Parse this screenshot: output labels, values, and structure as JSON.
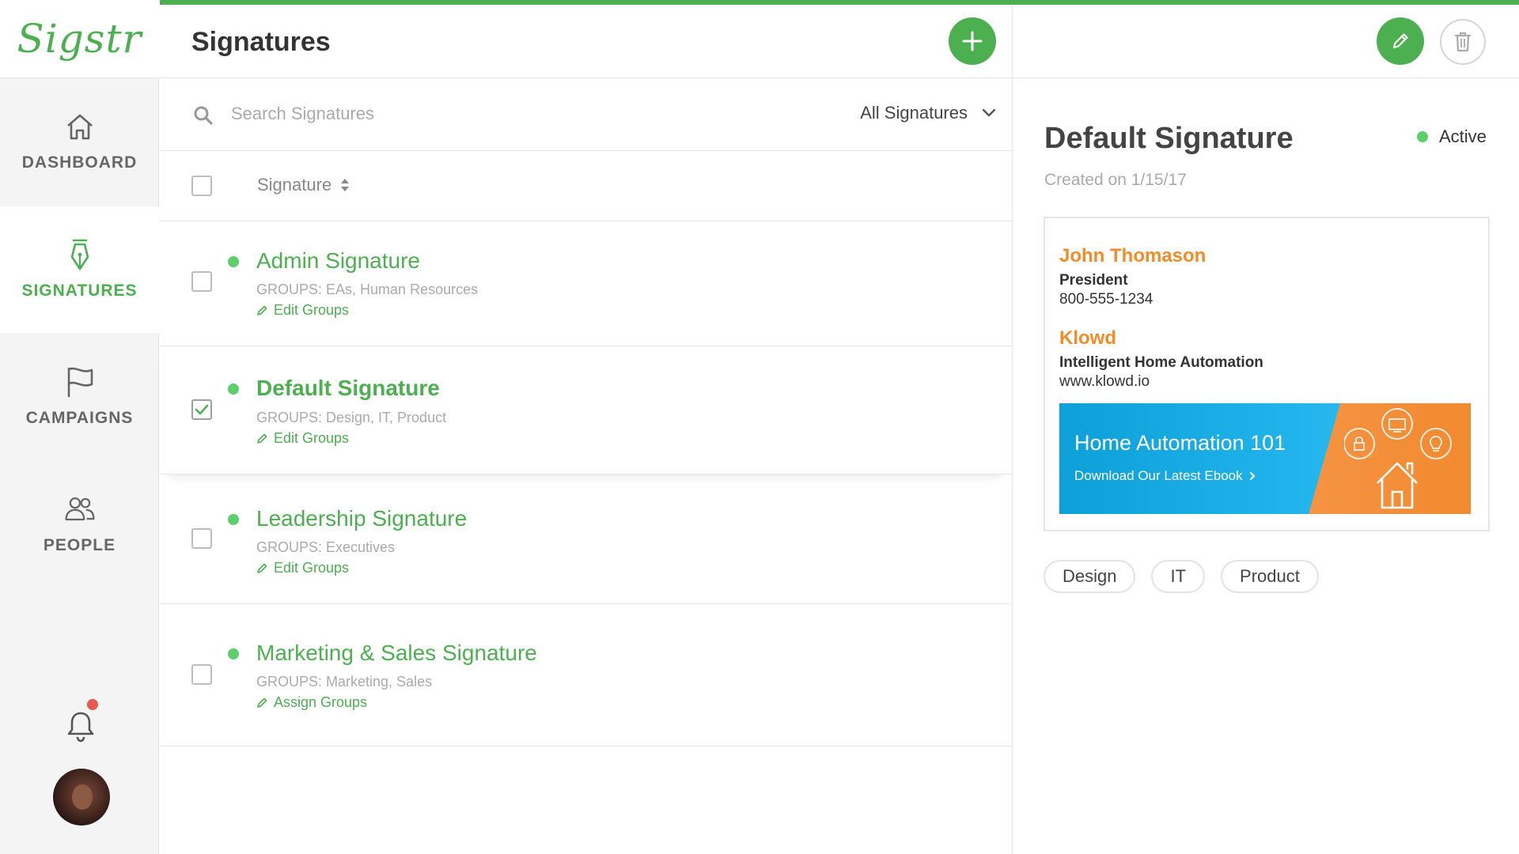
{
  "app": {
    "logo_text": "Sigstr",
    "accent_color": "#4caf50",
    "brand_orange": "#f28c28"
  },
  "sidebar": {
    "items": [
      {
        "label": "DASHBOARD",
        "icon": "home-icon",
        "active": false
      },
      {
        "label": "SIGNATURES",
        "icon": "pen-nib-icon",
        "active": true
      },
      {
        "label": "CAMPAIGNS",
        "icon": "flag-icon",
        "active": false
      },
      {
        "label": "PEOPLE",
        "icon": "people-icon",
        "active": false
      }
    ],
    "notifications": {
      "icon": "bell-icon",
      "has_unread": true
    }
  },
  "list": {
    "title": "Signatures",
    "search_placeholder": "Search Signatures",
    "filter_label": "All Signatures",
    "column_header": "Signature",
    "rows": [
      {
        "title": "Admin Signature",
        "groups": "GROUPS: EAs, Human Resources",
        "action": "Edit Groups",
        "checked": false,
        "status": "active"
      },
      {
        "title": "Default Signature",
        "groups": "GROUPS: Design, IT, Product",
        "action": "Edit Groups",
        "checked": true,
        "status": "active"
      },
      {
        "title": "Leadership Signature",
        "groups": "GROUPS: Executives",
        "action": "Edit Groups",
        "checked": false,
        "status": "active"
      },
      {
        "title": "Marketing & Sales Signature",
        "groups": "GROUPS: Marketing, Sales",
        "action": "Assign Groups",
        "checked": false,
        "status": "active"
      }
    ]
  },
  "detail": {
    "title": "Default Signature",
    "status": "Active",
    "created": "Created on 1/15/17",
    "signature": {
      "name": "John Thomason",
      "role": "President",
      "phone": "800-555-1234",
      "company": "Klowd",
      "tagline": "Intelligent Home Automation",
      "website": "www.klowd.io",
      "banner": {
        "title": "Home Automation 101",
        "subtitle": "Download Our Latest Ebook"
      }
    },
    "tags": [
      "Design",
      "IT",
      "Product"
    ]
  }
}
